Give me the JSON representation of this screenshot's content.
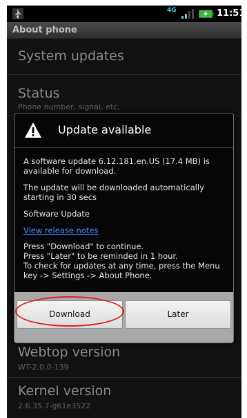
{
  "status_bar": {
    "network": "4G",
    "time": "11:51"
  },
  "title_bar": {
    "title": "About phone"
  },
  "list": {
    "items": [
      {
        "title": "System updates",
        "subtitle": ""
      },
      {
        "title": "Status",
        "subtitle": "Phone number, signal, etc."
      },
      {
        "title": "Webtop version",
        "subtitle": "WT-2.0.0-139"
      },
      {
        "title": "Kernel version",
        "subtitle": "2.6.35.7-g61e3522"
      }
    ]
  },
  "dialog": {
    "title": "Update available",
    "message": "A software update 6.12.181.en.US (17.4 MB) is available for download.",
    "auto_notice": "The update will be downloaded automatically starting in 30 secs",
    "label": "Software Update",
    "link": "View release notes",
    "instructions": {
      "line1": "Press \"Download\" to continue.",
      "line2": "Press \"Later\" to be reminded in 1 hour.",
      "line3": "To check for updates at any time, press the Menu key -> Settings -> About Phone."
    },
    "buttons": {
      "download": "Download",
      "later": "Later"
    }
  },
  "colors": {
    "highlight_ring": "#e02020",
    "link": "#4a8bff"
  }
}
